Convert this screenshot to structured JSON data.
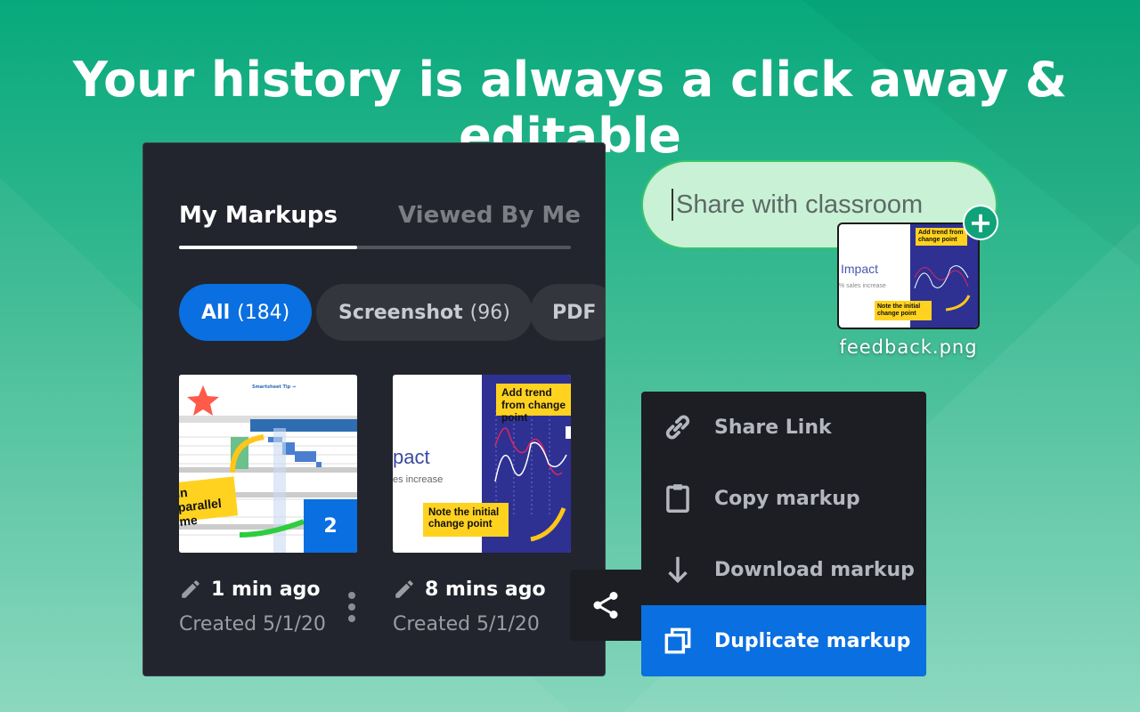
{
  "headline": "Your history is always a click away & editable",
  "panel": {
    "tabs": [
      {
        "label": "My Markups",
        "active": true
      },
      {
        "label": "Viewed By Me",
        "active": false
      }
    ],
    "filters": [
      {
        "label": "All",
        "count": "(184)",
        "active": true
      },
      {
        "label": "Screenshot",
        "count": "(96)",
        "active": false
      },
      {
        "label": "PDF",
        "count": "",
        "active": false
      }
    ],
    "items": [
      {
        "time": "1 min ago",
        "created": "Created 5/1/20",
        "badge": "2",
        "notes": [
          "in parallel",
          "me"
        ]
      },
      {
        "time": "8 mins ago",
        "created": "Created 5/1/20",
        "slide_title": "pact",
        "slide_sub": "es increase",
        "notes": [
          "Add trend from change point",
          "Note the initial change point"
        ]
      }
    ]
  },
  "context_menu": {
    "items": [
      {
        "label": "Share Link",
        "icon": "link-icon",
        "active": false
      },
      {
        "label": "Copy markup",
        "icon": "clipboard-icon",
        "active": false
      },
      {
        "label": "Download markup",
        "icon": "download-icon",
        "active": false
      },
      {
        "label": "Duplicate markup",
        "icon": "duplicate-icon",
        "active": true
      }
    ]
  },
  "share": {
    "placeholder": "Share with classroom",
    "file_name": "feedback.png",
    "thumb_title": "Impact",
    "thumb_sub": "% sales increase",
    "thumb_notes": [
      "Add trend from change point",
      "Note the initial change point"
    ]
  },
  "colors": {
    "accent": "#0a6fe0",
    "background": "#07a97c",
    "panel": "#22252d",
    "note": "#ffd21f",
    "plus": "#10a37a"
  }
}
